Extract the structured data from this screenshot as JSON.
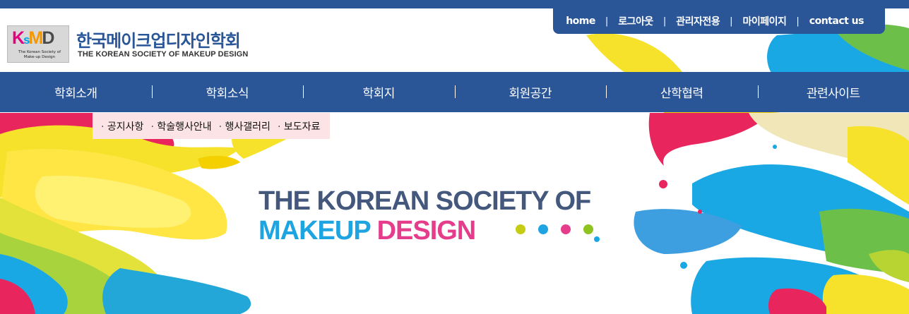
{
  "top_links": [
    {
      "label": "home"
    },
    {
      "label": "로그아웃"
    },
    {
      "label": "관리자전용"
    },
    {
      "label": "마이페이지"
    },
    {
      "label": "contact us"
    }
  ],
  "top_separator": "|",
  "logo": {
    "mark": [
      "K",
      "s",
      "M",
      "D"
    ],
    "sub_line1": "The Korean Society of",
    "sub_line2": "Make-up Design"
  },
  "site": {
    "title": "한국메이크업디자인학회",
    "subtitle": "THE KOREAN SOCIETY OF MAKEUP DESIGN"
  },
  "main_nav": [
    {
      "label": "학회소개"
    },
    {
      "label": "학회소식"
    },
    {
      "label": "학회지"
    },
    {
      "label": "회원공간"
    },
    {
      "label": "산학협력"
    },
    {
      "label": "관련사이트"
    }
  ],
  "sub_nav": [
    {
      "label": "공지사항"
    },
    {
      "label": "학술행사안내"
    },
    {
      "label": "행사갤러리"
    },
    {
      "label": "보도자료"
    }
  ],
  "hero": {
    "line1": "THE KOREAN SOCIETY OF",
    "line2_word1": "MAKEUP",
    "line2_word2": "DESIGN",
    "dot_colors": [
      "#c5cc12",
      "#1ea4e1",
      "#e63c8c",
      "#8fc31f"
    ]
  },
  "colors": {
    "brand_blue": "#2a5698",
    "subnav_bg": "#fbe3e6",
    "hero_navy": "#44587d",
    "hero_cyan": "#1ea4e1",
    "hero_pink": "#e63c8c"
  }
}
